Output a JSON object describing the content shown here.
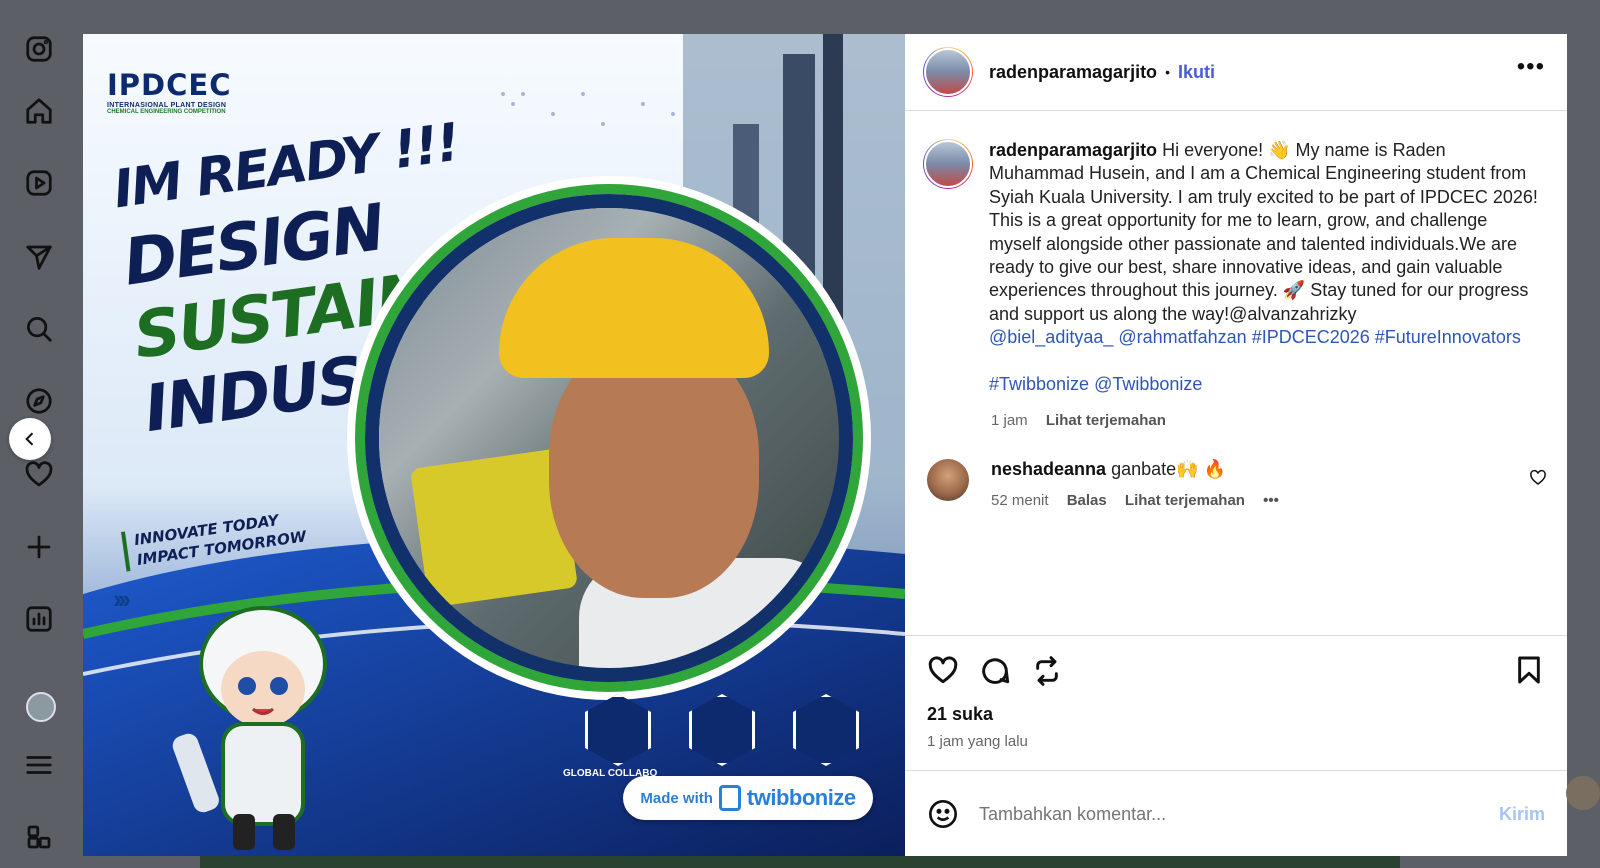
{
  "post": {
    "username": "radenparamagarjito",
    "follow_label": "Ikuti",
    "more_label": "•••",
    "caption": {
      "username": "radenparamagarjito",
      "text": "Hi everyone! 👋 My name is Raden Muhammad Husein, and I am a Chemical Engineering student from Syiah Kuala University. I am truly excited to be part of IPDCEC 2026! This is a great opportunity for me to learn, grow, and challenge myself alongside other passionate and talented individuals.We are ready to give our best, share innovative ideas, and gain valuable experiences throughout this journey. 🚀 Stay tuned for our progress and support us along the way!@alvanzahrizky",
      "links_line1": "@biel_adityaa_ @rahmatfahzan #IPDCEC2026 #FutureInnovators",
      "links_line2": "#Twibbonize @Twibbonize",
      "time": "1 jam",
      "translate": "Lihat terjemahan"
    },
    "comments": [
      {
        "username": "neshadeanna",
        "text": "ganbate🙌 🔥",
        "time": "52 menit",
        "reply": "Balas",
        "translate": "Lihat terjemahan",
        "more": "•••"
      }
    ],
    "likes": "21 suka",
    "posted_ago": "1 jam yang lalu",
    "comment_placeholder": "Tambahkan komentar...",
    "send_label": "Kirim"
  },
  "poster": {
    "logo": "IPDCEC",
    "logo_sub1": "INTERNASIONAL PLANT DESIGN",
    "logo_sub2": "CHEMICAL ENGINEERING COMPETITION",
    "headline": [
      "IM READY !!!",
      "DESIGN",
      "SUSTAIN",
      "INDUSTRY"
    ],
    "tagline": [
      "INNOVATE TODAY",
      "IMPACT TOMORROW"
    ],
    "badge_label": "GLOBAL COLLABO",
    "made_with": "Made with",
    "brand": "twibbonize"
  },
  "icons": {
    "rail": [
      "instagram-icon",
      "home-icon",
      "reels-icon",
      "direct-icon",
      "search-icon",
      "explore-icon",
      "heart-icon",
      "create-icon",
      "dashboard-icon",
      "profile-icon",
      "menu-icon",
      "apps-icon"
    ]
  }
}
